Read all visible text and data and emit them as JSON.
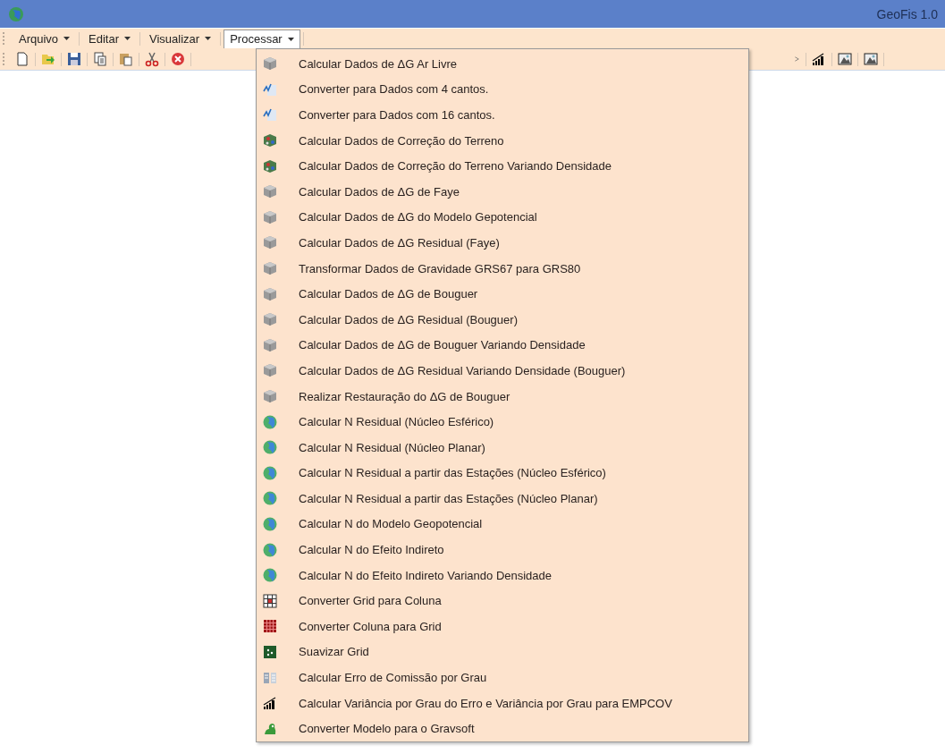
{
  "window": {
    "title": "GeoFis 1.0"
  },
  "menubar": [
    {
      "label": "Arquivo",
      "selected": false
    },
    {
      "label": "Editar",
      "selected": false
    },
    {
      "label": "Visualizar",
      "selected": false
    },
    {
      "label": "Processar",
      "selected": true
    }
  ],
  "toolbar_left": [
    {
      "kind": "new"
    },
    {
      "kind": "open"
    },
    {
      "kind": "save"
    },
    {
      "kind": "copy"
    },
    {
      "kind": "paste"
    },
    {
      "kind": "cut"
    },
    {
      "kind": "delete"
    }
  ],
  "toolbar_right": [
    {
      "kind": "arrow"
    },
    {
      "kind": "chart"
    },
    {
      "kind": "image"
    },
    {
      "kind": "image"
    }
  ],
  "menu": [
    {
      "label": "Calcular Dados de ΔG Ar Livre",
      "kind": "cube"
    },
    {
      "label": "Converter para Dados com 4 cantos.",
      "kind": "convert"
    },
    {
      "label": "Converter para Dados com 16 cantos.",
      "kind": "convert"
    },
    {
      "label": "Calcular Dados de Correção do Terreno",
      "kind": "terrain"
    },
    {
      "label": "Calcular Dados de Correção do Terreno Variando Densidade",
      "kind": "terrain"
    },
    {
      "label": "Calcular Dados de ΔG de Faye",
      "kind": "cube"
    },
    {
      "label": "Calcular Dados de ΔG do Modelo Gepotencial",
      "kind": "cube"
    },
    {
      "label": "Calcular Dados de ΔG Residual (Faye)",
      "kind": "cube"
    },
    {
      "label": "Transformar Dados de Gravidade GRS67 para GRS80",
      "kind": "cube"
    },
    {
      "label": "Calcular Dados de ΔG de Bouguer",
      "kind": "cube"
    },
    {
      "label": "Calcular Dados de ΔG Residual (Bouguer)",
      "kind": "cube"
    },
    {
      "label": "Calcular Dados de ΔG de Bouguer Variando Densidade",
      "kind": "cube"
    },
    {
      "label": "Calcular Dados de ΔG Residual Variando Densidade (Bouguer)",
      "kind": "cube"
    },
    {
      "label": "Realizar Restauração do ΔG de Bouguer",
      "kind": "cube"
    },
    {
      "label": "Calcular N Residual (Núcleo Esférico)",
      "kind": "globe"
    },
    {
      "label": "Calcular N Residual (Núcleo Planar)",
      "kind": "globe"
    },
    {
      "label": "Calcular N Residual a partir das Estações (Núcleo Esférico)",
      "kind": "globe"
    },
    {
      "label": "Calcular N Residual a partir das Estações (Núcleo Planar)",
      "kind": "globe"
    },
    {
      "label": "Calcular N do Modelo Geopotencial",
      "kind": "globe"
    },
    {
      "label": "Calcular N do Efeito Indireto",
      "kind": "globe"
    },
    {
      "label": "Calcular N do Efeito Indireto Variando Densidade",
      "kind": "globe"
    },
    {
      "label": "Converter Grid para Coluna",
      "kind": "grid"
    },
    {
      "label": "Converter Coluna para Grid",
      "kind": "redgrid"
    },
    {
      "label": "Suavizar Grid",
      "kind": "smooth"
    },
    {
      "label": "Calcular Erro de Comissão por Grau",
      "kind": "table"
    },
    {
      "label": "Calcular Variância por Grau do Erro e Variância por Grau para EMPCOV",
      "kind": "chart"
    },
    {
      "label": "Converter Modelo para o Gravsoft",
      "kind": "frog"
    }
  ]
}
